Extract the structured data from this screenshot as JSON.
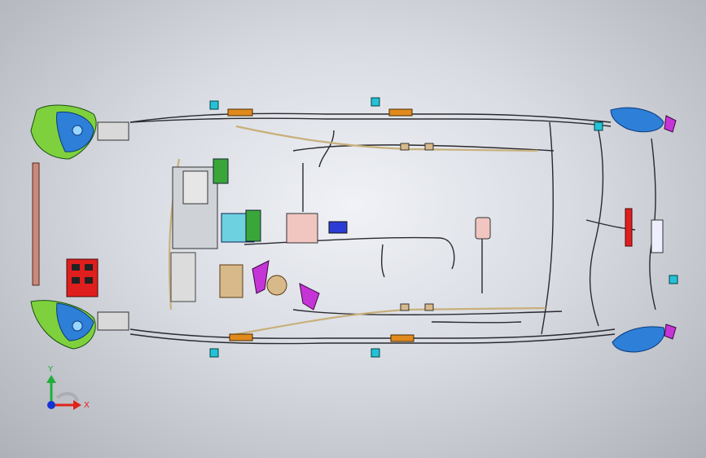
{
  "viewport": {
    "description_free": true,
    "triad": {
      "y_label": "Y",
      "x_label": "X",
      "colors": {
        "y": "#1fae3a",
        "x": "#e0231a",
        "z": "#1233d6"
      }
    }
  },
  "palette": {
    "wire_dark": "#2a2a2e",
    "wire_tan": "#c8b07a",
    "lamp_blue": "#2d7fd8",
    "lamp_green": "#7ed13c",
    "connector_red": "#e01e1e",
    "magenta": "#c535d6",
    "orange": "#e08a1e",
    "cyan": "#25c1d6",
    "grey_module": "#d9d9d9"
  }
}
